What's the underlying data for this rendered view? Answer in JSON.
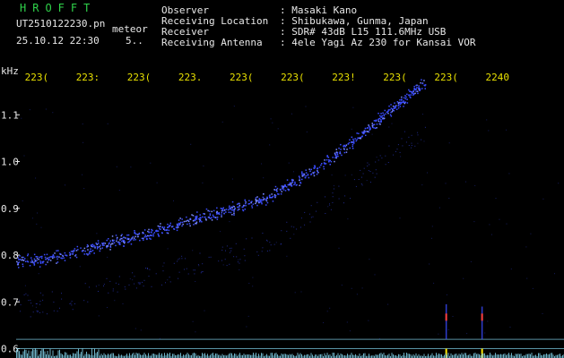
{
  "header": {
    "program": "HROFFT",
    "filename": "UT2510122230.pn",
    "meteor_label": "meteor",
    "datetime": "25.10.12 22:30",
    "count": "5..",
    "fields": [
      {
        "label": "Observer",
        "value": ": Masaki Kano"
      },
      {
        "label": "Receiving Location",
        "value": ": Shibukawa, Gunma, Japan"
      },
      {
        "label": "Receiver",
        "value": ": SDR# 43dB L15 111.6MHz USB"
      },
      {
        "label": "Receiving Antenna",
        "value": ": 4ele Yagi Az 230 for Kansai VOR"
      }
    ]
  },
  "colors": {
    "background": "#000000",
    "label_text": "#e8e8e8",
    "program_text": "#2fd24a",
    "time_ticks": "#e8e000",
    "signal": "#3a4cff",
    "signal_bright": "#7e8dff",
    "reference_line": "#7fd0e8",
    "meteor_ping": "#ffe800"
  },
  "chart_data": {
    "type": "scatter",
    "title": "",
    "ylabel": "kHz",
    "ylim": [
      0.58,
      1.2
    ],
    "ytick_labels": [
      "1.1",
      "1.0",
      "0.9",
      "0.8",
      "0.7",
      "0.6"
    ],
    "yticks": [
      1.1,
      1.0,
      0.9,
      0.8,
      0.7,
      0.6
    ],
    "xlim": [
      2229.6,
      2240.3
    ],
    "xticks": [
      2230,
      2231,
      2232,
      2233,
      2234,
      2235,
      2236,
      2237,
      2238,
      2239,
      2240
    ],
    "xtick_labels": [
      "223(",
      "223:",
      "223(",
      "223.",
      "223(",
      "223(",
      "223!",
      "223(",
      "223(",
      "2240"
    ],
    "series": [
      {
        "x": [
          2229.6,
          2230.0,
          2230.5,
          2231.0,
          2231.5,
          2232.0,
          2232.5,
          2233.0,
          2233.5,
          2234.0,
          2234.5,
          2235.0,
          2235.5,
          2236.0,
          2236.5,
          2237.0,
          2237.3,
          2237.6
        ],
        "y": [
          0.787,
          0.79,
          0.8,
          0.812,
          0.83,
          0.84,
          0.857,
          0.875,
          0.89,
          0.905,
          0.925,
          0.955,
          0.99,
          1.03,
          1.075,
          1.12,
          1.145,
          1.17
        ]
      }
    ],
    "meteor_pings": [
      {
        "x": 2238.0,
        "y_top": 0.695
      },
      {
        "x": 2238.7,
        "y_top": 0.69
      }
    ],
    "reference_lines": [
      0.62,
      0.6
    ]
  }
}
